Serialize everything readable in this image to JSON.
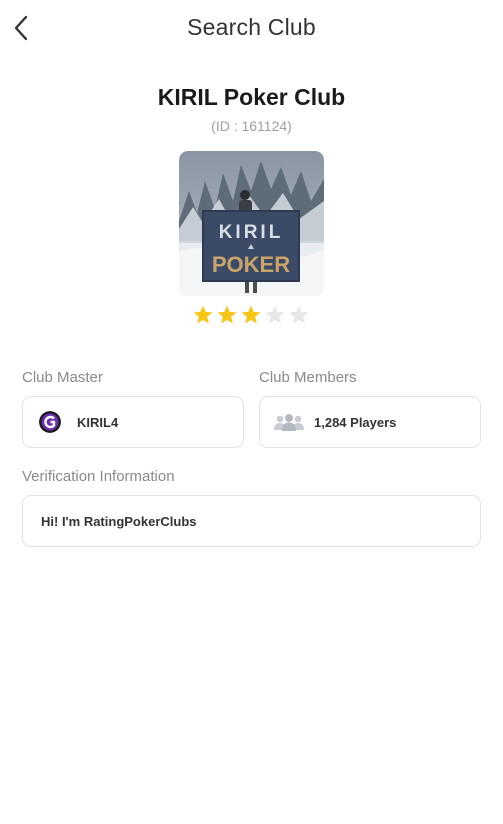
{
  "header": {
    "title": "Search Club"
  },
  "club": {
    "name": "KIRIL Poker Club",
    "id_text": "(ID : 161124)",
    "banner_line1": "KIRIL",
    "banner_line2": "POKER",
    "rating": 3,
    "rating_max": 5
  },
  "master": {
    "label": "Club Master",
    "name": "KIRIL4"
  },
  "members": {
    "label": "Club Members",
    "count_text": "1,284 Players"
  },
  "verification": {
    "label": "Verification Information",
    "message": "Hi! I'm RatingPokerClubs"
  },
  "colors": {
    "star_filled": "#f5c518",
    "star_empty": "#e6e6e6",
    "label_gray": "#8a8a8a",
    "border": "#e3e3e3"
  },
  "icons": {
    "back": "chevron-left-icon",
    "members": "people-group-icon",
    "star": "star-icon"
  }
}
